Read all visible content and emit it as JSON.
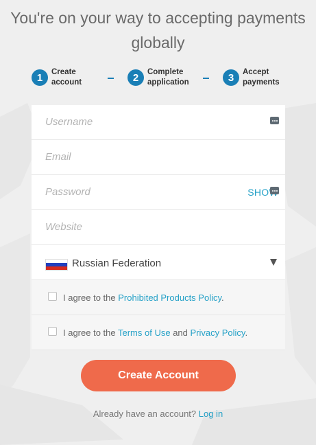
{
  "headline": "You're on your way to accepting payments globally",
  "steps": [
    {
      "number": "1",
      "line1": "Create",
      "line2": "account"
    },
    {
      "number": "2",
      "line1": "Complete",
      "line2": "application"
    },
    {
      "number": "3",
      "line1": "Accept",
      "line2": "payments"
    }
  ],
  "form": {
    "username_placeholder": "Username",
    "email_placeholder": "Email",
    "password_placeholder": "Password",
    "show_label": "SHOW",
    "website_placeholder": "Website",
    "country": "Russian Federation",
    "agree_prefix": "I agree to the ",
    "prohibited_policy_link": "Prohibited Products Policy",
    "agree_period": ".",
    "terms_link": "Terms of Use",
    "and_word": " and ",
    "privacy_link": "Privacy Policy",
    "create_button": "Create Account"
  },
  "login": {
    "prompt": "Already have an account? ",
    "link": "Log in"
  },
  "colors": {
    "accent_blue": "#1a7fb6",
    "link_blue": "#25a1c7",
    "cta_orange": "#ef6a4b"
  },
  "icons": {
    "field_icon": "password-manager-dots-icon",
    "dropdown": "caret-down-icon",
    "flag": "russia-flag"
  }
}
